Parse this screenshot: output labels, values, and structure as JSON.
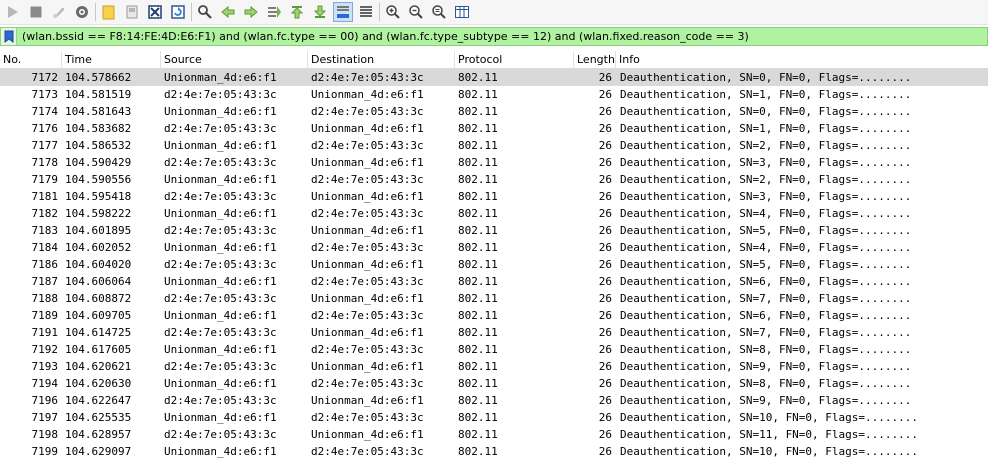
{
  "toolbar": {
    "buttons": [
      "start-capture-icon",
      "stop-capture-icon",
      "restart-capture-icon",
      "capture-options-icon",
      "open-file-icon",
      "save-file-icon",
      "close-file-icon",
      "reload-file-icon",
      "find-packet-icon",
      "go-back-icon",
      "go-forward-icon",
      "go-to-packet-icon",
      "go-first-packet-icon",
      "go-last-packet-icon",
      "autoscroll-icon",
      "colorize-icon",
      "zoom-in-icon",
      "zoom-out-icon",
      "zoom-normal-icon",
      "resize-columns-icon"
    ]
  },
  "filter": {
    "expression": "(wlan.bssid == F8:14:FE:4D:E6:F1) and (wlan.fc.type == 00) and (wlan.fc.type_subtype == 12) and (wlan.fixed.reason_code == 3)",
    "bg_color": "#b0f2a0"
  },
  "columns": {
    "no": "No.",
    "time": "Time",
    "source": "Source",
    "destination": "Destination",
    "protocol": "Protocol",
    "length": "Length",
    "info": "Info"
  },
  "packets": [
    {
      "no": "7172",
      "time": "104.578662",
      "source": "Unionman_4d:e6:f1",
      "destination": "d2:4e:7e:05:43:3c",
      "protocol": "802.11",
      "length": "26",
      "info": "Deauthentication, SN=0, FN=0, Flags=........"
    },
    {
      "no": "7173",
      "time": "104.581519",
      "source": "d2:4e:7e:05:43:3c",
      "destination": "Unionman_4d:e6:f1",
      "protocol": "802.11",
      "length": "26",
      "info": "Deauthentication, SN=1, FN=0, Flags=........"
    },
    {
      "no": "7174",
      "time": "104.581643",
      "source": "Unionman_4d:e6:f1",
      "destination": "d2:4e:7e:05:43:3c",
      "protocol": "802.11",
      "length": "26",
      "info": "Deauthentication, SN=0, FN=0, Flags=........"
    },
    {
      "no": "7176",
      "time": "104.583682",
      "source": "d2:4e:7e:05:43:3c",
      "destination": "Unionman_4d:e6:f1",
      "protocol": "802.11",
      "length": "26",
      "info": "Deauthentication, SN=1, FN=0, Flags=........"
    },
    {
      "no": "7177",
      "time": "104.586532",
      "source": "Unionman_4d:e6:f1",
      "destination": "d2:4e:7e:05:43:3c",
      "protocol": "802.11",
      "length": "26",
      "info": "Deauthentication, SN=2, FN=0, Flags=........"
    },
    {
      "no": "7178",
      "time": "104.590429",
      "source": "d2:4e:7e:05:43:3c",
      "destination": "Unionman_4d:e6:f1",
      "protocol": "802.11",
      "length": "26",
      "info": "Deauthentication, SN=3, FN=0, Flags=........"
    },
    {
      "no": "7179",
      "time": "104.590556",
      "source": "Unionman_4d:e6:f1",
      "destination": "d2:4e:7e:05:43:3c",
      "protocol": "802.11",
      "length": "26",
      "info": "Deauthentication, SN=2, FN=0, Flags=........"
    },
    {
      "no": "7181",
      "time": "104.595418",
      "source": "d2:4e:7e:05:43:3c",
      "destination": "Unionman_4d:e6:f1",
      "protocol": "802.11",
      "length": "26",
      "info": "Deauthentication, SN=3, FN=0, Flags=........"
    },
    {
      "no": "7182",
      "time": "104.598222",
      "source": "Unionman_4d:e6:f1",
      "destination": "d2:4e:7e:05:43:3c",
      "protocol": "802.11",
      "length": "26",
      "info": "Deauthentication, SN=4, FN=0, Flags=........"
    },
    {
      "no": "7183",
      "time": "104.601895",
      "source": "d2:4e:7e:05:43:3c",
      "destination": "Unionman_4d:e6:f1",
      "protocol": "802.11",
      "length": "26",
      "info": "Deauthentication, SN=5, FN=0, Flags=........"
    },
    {
      "no": "7184",
      "time": "104.602052",
      "source": "Unionman_4d:e6:f1",
      "destination": "d2:4e:7e:05:43:3c",
      "protocol": "802.11",
      "length": "26",
      "info": "Deauthentication, SN=4, FN=0, Flags=........"
    },
    {
      "no": "7186",
      "time": "104.604020",
      "source": "d2:4e:7e:05:43:3c",
      "destination": "Unionman_4d:e6:f1",
      "protocol": "802.11",
      "length": "26",
      "info": "Deauthentication, SN=5, FN=0, Flags=........"
    },
    {
      "no": "7187",
      "time": "104.606064",
      "source": "Unionman_4d:e6:f1",
      "destination": "d2:4e:7e:05:43:3c",
      "protocol": "802.11",
      "length": "26",
      "info": "Deauthentication, SN=6, FN=0, Flags=........"
    },
    {
      "no": "7188",
      "time": "104.608872",
      "source": "d2:4e:7e:05:43:3c",
      "destination": "Unionman_4d:e6:f1",
      "protocol": "802.11",
      "length": "26",
      "info": "Deauthentication, SN=7, FN=0, Flags=........"
    },
    {
      "no": "7189",
      "time": "104.609705",
      "source": "Unionman_4d:e6:f1",
      "destination": "d2:4e:7e:05:43:3c",
      "protocol": "802.11",
      "length": "26",
      "info": "Deauthentication, SN=6, FN=0, Flags=........"
    },
    {
      "no": "7191",
      "time": "104.614725",
      "source": "d2:4e:7e:05:43:3c",
      "destination": "Unionman_4d:e6:f1",
      "protocol": "802.11",
      "length": "26",
      "info": "Deauthentication, SN=7, FN=0, Flags=........"
    },
    {
      "no": "7192",
      "time": "104.617605",
      "source": "Unionman_4d:e6:f1",
      "destination": "d2:4e:7e:05:43:3c",
      "protocol": "802.11",
      "length": "26",
      "info": "Deauthentication, SN=8, FN=0, Flags=........"
    },
    {
      "no": "7193",
      "time": "104.620621",
      "source": "d2:4e:7e:05:43:3c",
      "destination": "Unionman_4d:e6:f1",
      "protocol": "802.11",
      "length": "26",
      "info": "Deauthentication, SN=9, FN=0, Flags=........"
    },
    {
      "no": "7194",
      "time": "104.620630",
      "source": "Unionman_4d:e6:f1",
      "destination": "d2:4e:7e:05:43:3c",
      "protocol": "802.11",
      "length": "26",
      "info": "Deauthentication, SN=8, FN=0, Flags=........"
    },
    {
      "no": "7196",
      "time": "104.622647",
      "source": "d2:4e:7e:05:43:3c",
      "destination": "Unionman_4d:e6:f1",
      "protocol": "802.11",
      "length": "26",
      "info": "Deauthentication, SN=9, FN=0, Flags=........"
    },
    {
      "no": "7197",
      "time": "104.625535",
      "source": "Unionman_4d:e6:f1",
      "destination": "d2:4e:7e:05:43:3c",
      "protocol": "802.11",
      "length": "26",
      "info": "Deauthentication, SN=10, FN=0, Flags=........"
    },
    {
      "no": "7198",
      "time": "104.628957",
      "source": "d2:4e:7e:05:43:3c",
      "destination": "Unionman_4d:e6:f1",
      "protocol": "802.11",
      "length": "26",
      "info": "Deauthentication, SN=11, FN=0, Flags=........"
    },
    {
      "no": "7199",
      "time": "104.629097",
      "source": "Unionman_4d:e6:f1",
      "destination": "d2:4e:7e:05:43:3c",
      "protocol": "802.11",
      "length": "26",
      "info": "Deauthentication, SN=10, FN=0, Flags=........"
    }
  ],
  "selected_row": 0
}
